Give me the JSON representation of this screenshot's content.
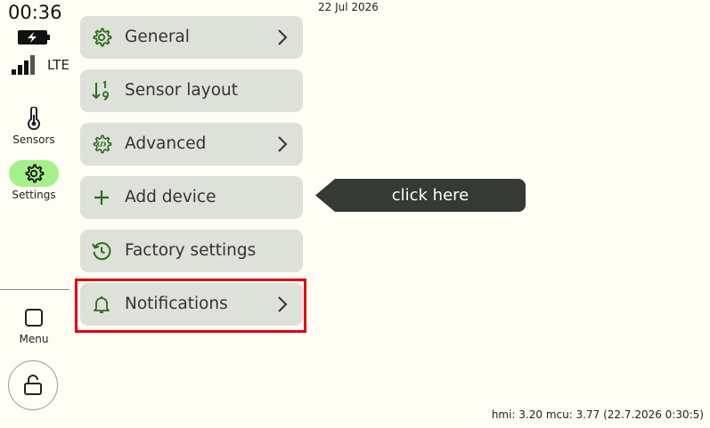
{
  "status": {
    "time": "00:36",
    "network": "LTE",
    "date": "22 Jul 2026"
  },
  "rail": {
    "sensors_label": "Sensors",
    "settings_label": "Settings",
    "menu_label": "Menu"
  },
  "menu": {
    "items": [
      {
        "label": "General",
        "icon": "gear-icon",
        "has_chevron": true
      },
      {
        "label": "Sensor layout",
        "icon": "sort-numeric-icon",
        "has_chevron": false
      },
      {
        "label": "Advanced",
        "icon": "code-gear-icon",
        "has_chevron": true
      },
      {
        "label": "Add device",
        "icon": "plus-icon",
        "has_chevron": false
      },
      {
        "label": "Factory settings",
        "icon": "history-icon",
        "has_chevron": false
      },
      {
        "label": "Notifications",
        "icon": "bell-icon",
        "has_chevron": true
      }
    ],
    "highlighted_item": "Notifications"
  },
  "tooltip": {
    "text": "click here"
  },
  "footer": {
    "version": "hmi: 3.20 mcu: 3.77 (22.7.2026 0:30:5)"
  },
  "colors": {
    "background": "#fffdf4",
    "button_bg": "#dde1d9",
    "icon_green": "#2e6b1a",
    "active_pill": "#a6f08a",
    "highlight_red": "#e3000f",
    "tooltip_bg": "#353a35"
  }
}
